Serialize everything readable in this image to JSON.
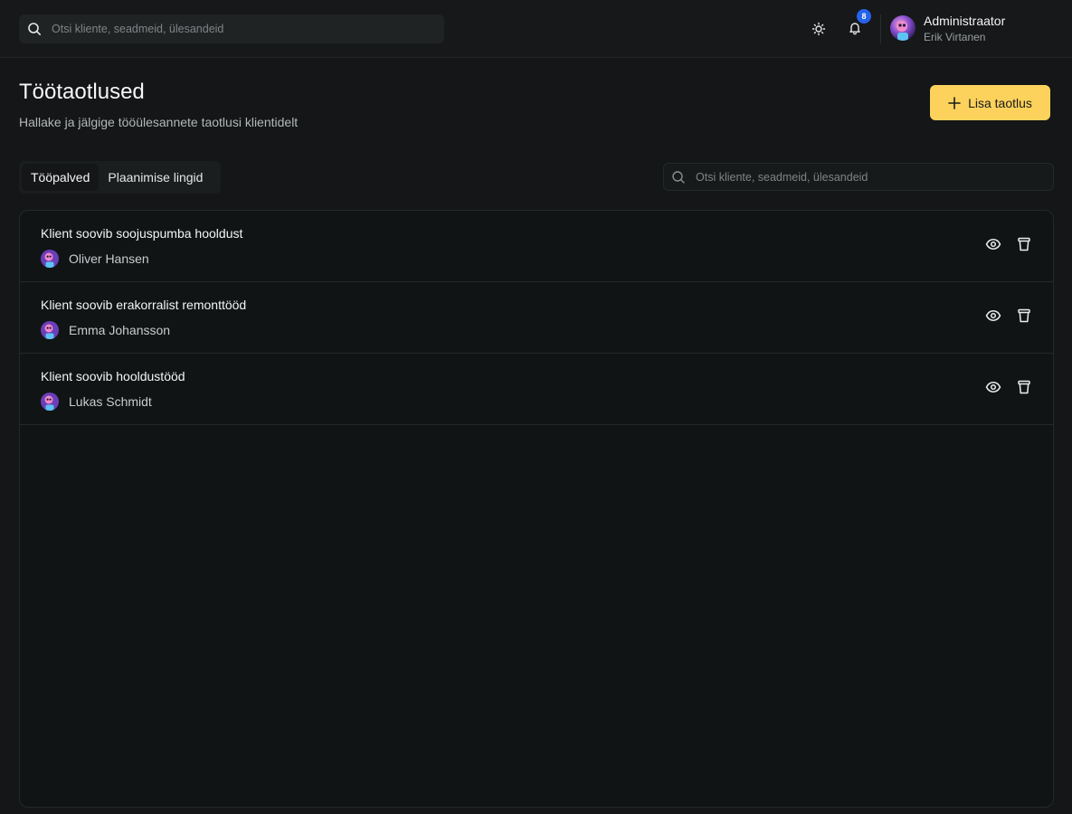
{
  "header": {
    "search_placeholder": "Otsi kliente, seadmeid, ülesandeid",
    "notifications_count": "8",
    "user": {
      "role": "Administraator",
      "name": "Erik Virtanen"
    }
  },
  "page": {
    "title": "Töötaotlused",
    "subtitle": "Hallake ja jälgige tööülesannete taotlusi klientidelt",
    "add_button_label": "Lisa taotlus"
  },
  "tabs": [
    {
      "label": "Tööpalved",
      "active": true
    },
    {
      "label": "Plaanimise lingid",
      "active": false
    }
  ],
  "list_search_placeholder": "Otsi kliente, seadmeid, ülesandeid",
  "requests": [
    {
      "title": "Klient soovib soojuspumba hooldust",
      "client": "Oliver Hansen"
    },
    {
      "title": "Klient soovib erakorralist remonttööd",
      "client": "Emma Johansson"
    },
    {
      "title": "Klient soovib hooldustööd",
      "client": "Lukas Schmidt"
    }
  ],
  "colors": {
    "accent": "#fcd25c",
    "badge": "#2563eb",
    "background": "#141617"
  }
}
